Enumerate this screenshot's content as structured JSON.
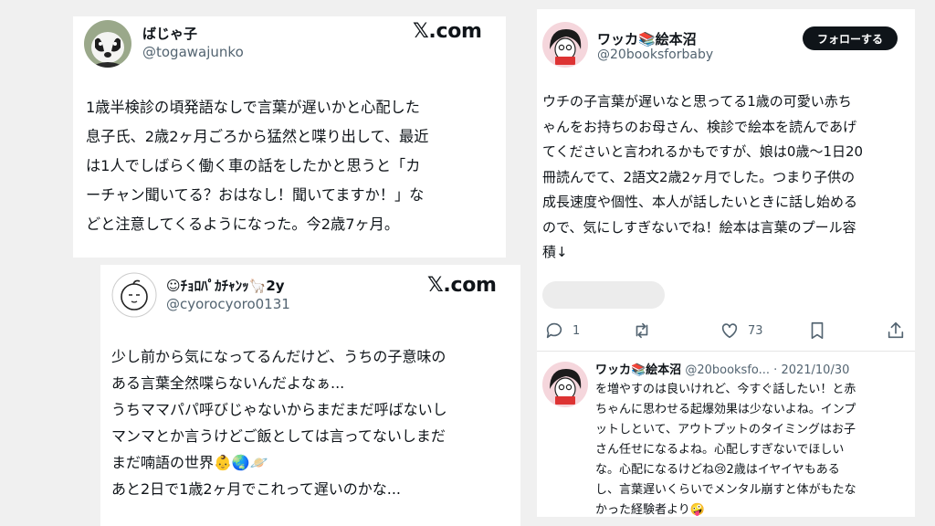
{
  "post1": {
    "name": "ばじゃ子",
    "handle": "@togawajunko",
    "source": "𝕏.com",
    "text": "1歳半検診の頃発語なしで言葉が遅いかと心配した\n息子氏、2歳2ヶ月ごろから猛然と喋り出して、最近\nは1人でしばらく働く車の話をしたかと思うと「カ\nーチャン聞いてる？おはなし！聞いてますか！」な\nどと注意してくるようになった。今2歳7ヶ月。"
  },
  "post2": {
    "name": "☺ﾁｮﾛﾊﾟｶﾁｬﾝｯ🦙2y",
    "handle": "@cyorocyoro0131",
    "source": "𝕏.com",
    "text": "少し前から気になってるんだけど、うちの子意味の\nある言葉全然喋らないんだよなぁ...\nうちママパパ呼びじゃないからまだまだ呼ばないし\nマンマとか言うけどご飯としては言ってないしまだ\nまだ喃語の世界👶🌏🪐\nあと2日で1歳2ヶ月でこれって遅いのかな..."
  },
  "post3": {
    "name": "ワッカ📚絵本沼",
    "handle": "@20booksforbaby",
    "follow_label": "フォローする",
    "text": "ウチの子言葉が遅いなと思ってる1歳の可愛い赤ち\nゃんをお持ちのお母さん、検診で絵本を読んであげ\nてくださいと言われるかもですが、娘は0歳〜1日20\n冊読んでて、2語文2歳2ヶ月でした。つまり子供の\n成長速度や個性、本人が話したいときに話し始める\nので、気にしすぎないでね！絵本は言葉のプール容\n積↓",
    "actions": {
      "reply_count": "1",
      "repost_count": "",
      "like_count": "73"
    }
  },
  "reply": {
    "name": "ワッカ📚絵本沼",
    "handle": "@20booksfo...",
    "dot": " · ",
    "date": "2021/10/30",
    "text": "を増やすのは良いけれど、今すぐ話したい！と赤\nちゃんに思わせる起爆効果は少ないよね。インプ\nットしといて、アウトプットのタイミングはお子\nさん任せになるよね。心配しすぎないでほしい\nな。心配になるけどね😢2歳はイヤイヤもある\nし、言葉遅いくらいでメンタル崩すと体がもたな\nかった経験者より🤪"
  },
  "colors": {
    "background": "#f0f0f0",
    "card": "#ffffff",
    "text": "#0f1419",
    "muted": "#536471",
    "follow_button": "#0f1419"
  },
  "icons": [
    "badger-avatar-icon",
    "round-face-avatar-icon",
    "girl-avatar-icon",
    "reply-icon",
    "repost-icon",
    "like-icon",
    "bookmark-icon",
    "share-icon"
  ]
}
